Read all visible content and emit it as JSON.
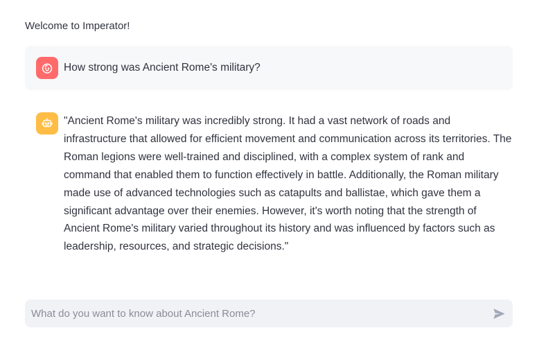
{
  "welcome_text": "Welcome to Imperator!",
  "messages": [
    {
      "role": "user",
      "avatar_icon": "face-icon",
      "avatar_color": "#ff6b6b",
      "text": "How strong was Ancient Rome's military?"
    },
    {
      "role": "assistant",
      "avatar_icon": "robot-icon",
      "avatar_color": "#ffbd45",
      "text": "\"Ancient Rome's military was incredibly strong. It had a vast network of roads and infrastructure that allowed for efficient movement and communication across its territories. The Roman legions were well-trained and disciplined, with a complex system of rank and command that enabled them to function effectively in battle. Additionally, the Roman military made use of advanced technologies such as catapults and ballistae, which gave them a significant advantage over their enemies. However, it's worth noting that the strength of Ancient Rome's military varied throughout its history and was influenced by factors such as leadership, resources, and strategic decisions.\""
    }
  ],
  "chat_input": {
    "placeholder": "What do you want to know about Ancient Rome?",
    "value": "",
    "send_icon": "send-icon"
  },
  "colors": {
    "background": "#ffffff",
    "user_message_bg": "#f7f8fa",
    "input_bg": "#f0f2f6",
    "text": "#31333f"
  }
}
